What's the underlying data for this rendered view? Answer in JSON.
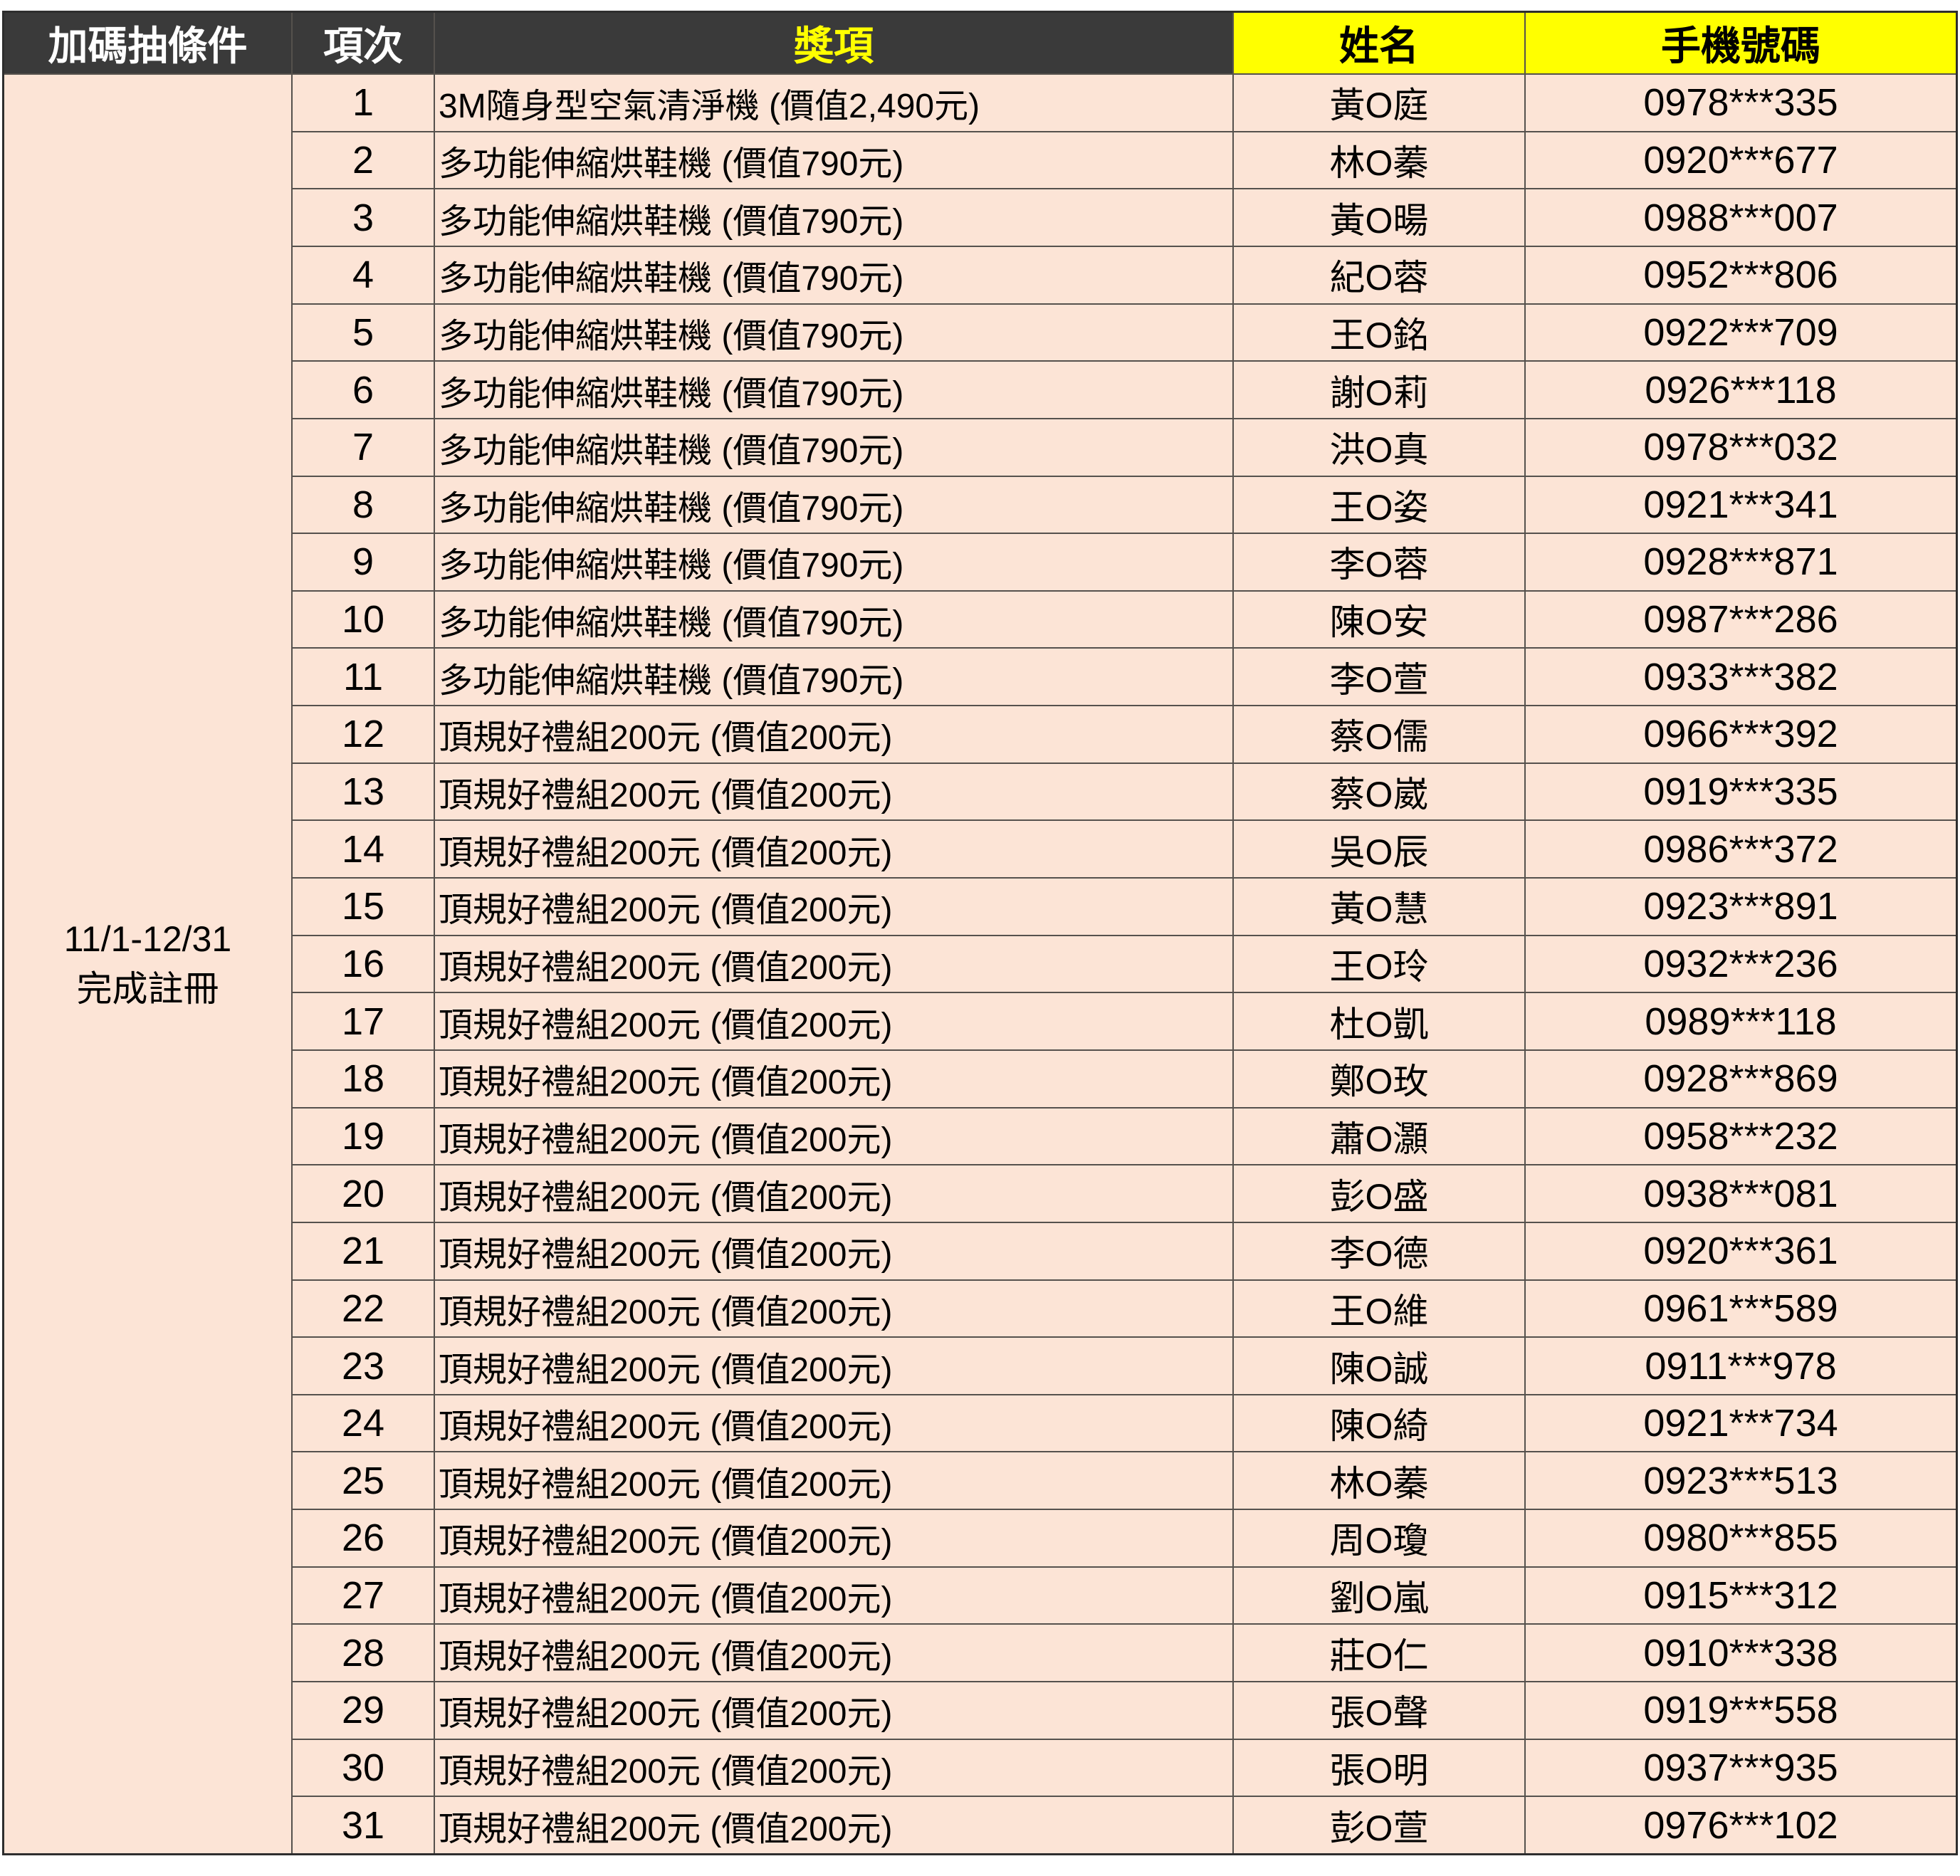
{
  "table": {
    "headers": {
      "condition": "加碼抽條件",
      "index": "項次",
      "prize": "獎項",
      "name": "姓名",
      "phone": "手機號碼"
    },
    "condition": {
      "line1": "11/1-12/31",
      "line2": "完成註冊"
    },
    "rows": [
      {
        "no": "1",
        "prize": "3M隨身型空氣清淨機 (價值2,490元)",
        "name": "黃O庭",
        "phone": "0978***335"
      },
      {
        "no": "2",
        "prize": "多功能伸縮烘鞋機 (價值790元)",
        "name": "林O蓁",
        "phone": "0920***677"
      },
      {
        "no": "3",
        "prize": "多功能伸縮烘鞋機 (價值790元)",
        "name": "黃O暘",
        "phone": "0988***007"
      },
      {
        "no": "4",
        "prize": "多功能伸縮烘鞋機 (價值790元)",
        "name": "紀O蓉",
        "phone": "0952***806"
      },
      {
        "no": "5",
        "prize": "多功能伸縮烘鞋機 (價值790元)",
        "name": "王O銘",
        "phone": "0922***709"
      },
      {
        "no": "6",
        "prize": "多功能伸縮烘鞋機 (價值790元)",
        "name": "謝O莉",
        "phone": "0926***118"
      },
      {
        "no": "7",
        "prize": "多功能伸縮烘鞋機 (價值790元)",
        "name": "洪O真",
        "phone": "0978***032"
      },
      {
        "no": "8",
        "prize": "多功能伸縮烘鞋機 (價值790元)",
        "name": "王O姿",
        "phone": "0921***341"
      },
      {
        "no": "9",
        "prize": "多功能伸縮烘鞋機 (價值790元)",
        "name": "李O蓉",
        "phone": "0928***871"
      },
      {
        "no": "10",
        "prize": "多功能伸縮烘鞋機 (價值790元)",
        "name": "陳O安",
        "phone": "0987***286"
      },
      {
        "no": "11",
        "prize": "多功能伸縮烘鞋機 (價值790元)",
        "name": "李O萱",
        "phone": "0933***382"
      },
      {
        "no": "12",
        "prize": "頂規好禮組200元 (價值200元)",
        "name": "蔡O儒",
        "phone": "0966***392"
      },
      {
        "no": "13",
        "prize": "頂規好禮組200元 (價值200元)",
        "name": "蔡O崴",
        "phone": "0919***335"
      },
      {
        "no": "14",
        "prize": "頂規好禮組200元 (價值200元)",
        "name": "吳O辰",
        "phone": "0986***372"
      },
      {
        "no": "15",
        "prize": "頂規好禮組200元 (價值200元)",
        "name": "黃O慧",
        "phone": "0923***891"
      },
      {
        "no": "16",
        "prize": "頂規好禮組200元 (價值200元)",
        "name": "王O玲",
        "phone": "0932***236"
      },
      {
        "no": "17",
        "prize": "頂規好禮組200元 (價值200元)",
        "name": "杜O凱",
        "phone": "0989***118"
      },
      {
        "no": "18",
        "prize": "頂規好禮組200元 (價值200元)",
        "name": "鄭O玫",
        "phone": "0928***869"
      },
      {
        "no": "19",
        "prize": "頂規好禮組200元 (價值200元)",
        "name": "蕭O灝",
        "phone": "0958***232"
      },
      {
        "no": "20",
        "prize": "頂規好禮組200元 (價值200元)",
        "name": "彭O盛",
        "phone": "0938***081"
      },
      {
        "no": "21",
        "prize": "頂規好禮組200元 (價值200元)",
        "name": "李O德",
        "phone": "0920***361"
      },
      {
        "no": "22",
        "prize": "頂規好禮組200元 (價值200元)",
        "name": "王O維",
        "phone": "0961***589"
      },
      {
        "no": "23",
        "prize": "頂規好禮組200元 (價值200元)",
        "name": "陳O誠",
        "phone": "0911***978"
      },
      {
        "no": "24",
        "prize": "頂規好禮組200元 (價值200元)",
        "name": "陳O綺",
        "phone": "0921***734"
      },
      {
        "no": "25",
        "prize": "頂規好禮組200元 (價值200元)",
        "name": "林O蓁",
        "phone": "0923***513"
      },
      {
        "no": "26",
        "prize": "頂規好禮組200元 (價值200元)",
        "name": "周O瓊",
        "phone": "0980***855"
      },
      {
        "no": "27",
        "prize": "頂規好禮組200元 (價值200元)",
        "name": "劉O嵐",
        "phone": "0915***312"
      },
      {
        "no": "28",
        "prize": "頂規好禮組200元 (價值200元)",
        "name": "莊O仁",
        "phone": "0910***338"
      },
      {
        "no": "29",
        "prize": "頂規好禮組200元 (價值200元)",
        "name": "張O聲",
        "phone": "0919***558"
      },
      {
        "no": "30",
        "prize": "頂規好禮組200元 (價值200元)",
        "name": "張O明",
        "phone": "0937***935"
      },
      {
        "no": "31",
        "prize": "頂規好禮組200元 (價值200元)",
        "name": "彭O萱",
        "phone": "0976***102"
      }
    ]
  },
  "colors": {
    "header_bg": "#3A3A3A",
    "header_text": "#FFFFFF",
    "prize_header_text": "#FFFF00",
    "highlight_header_bg": "#FFFF00",
    "highlight_header_text": "#000000",
    "row_bg": "#FCE4D6",
    "grid_line": "#55514D",
    "page_bg": "#FFFFFF"
  }
}
